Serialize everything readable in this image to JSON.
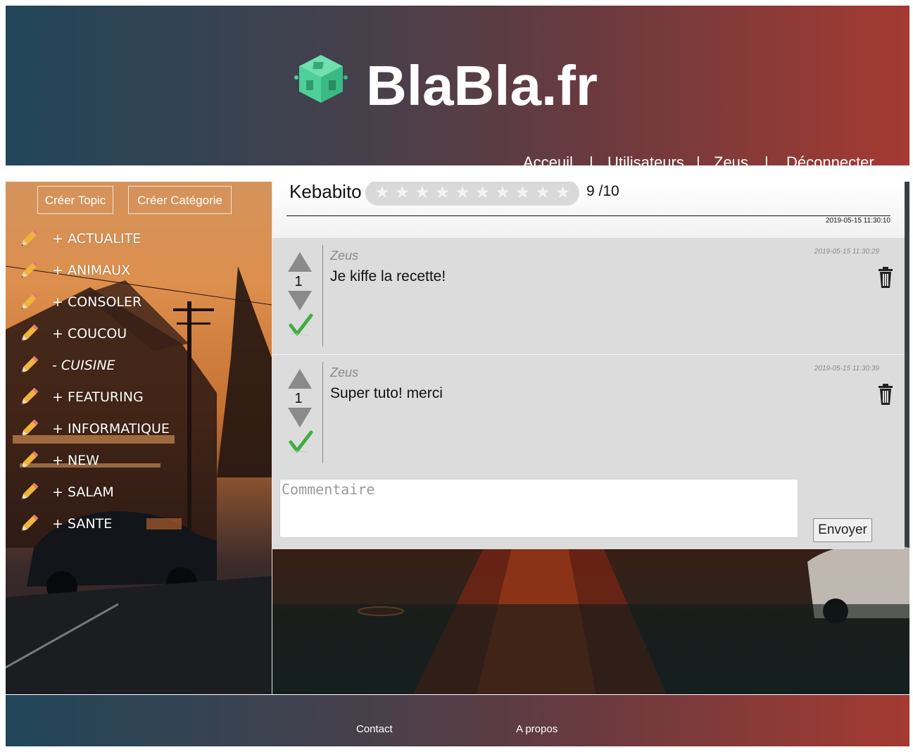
{
  "header": {
    "site_title": "BlaBla.fr",
    "logo_icon": "cube-logo-icon",
    "nav": {
      "home": "Acceuil",
      "users": "Utilisateurs",
      "profile": "Zeus",
      "logout": "Déconnecter",
      "separator": "|"
    }
  },
  "sidebar": {
    "create_topic": "Créer Topic",
    "create_category": "Créer Catégorie",
    "categories": [
      {
        "label": "+ ACTUALITE",
        "icon": "pencil-icon"
      },
      {
        "label": "+ ANIMAUX",
        "icon": "pencil-icon"
      },
      {
        "label": "+ CONSOLER",
        "icon": "pencil-icon"
      },
      {
        "label": "+ COUCOU",
        "icon": "pencil-icon"
      },
      {
        "label": "- CUISINE",
        "icon": "pencil-icon",
        "active": true
      },
      {
        "label": "+ FEATURING",
        "icon": "pencil-icon"
      },
      {
        "label": "+ INFORMATIQUE",
        "icon": "pencil-icon"
      },
      {
        "label": "+ NEW",
        "icon": "pencil-icon"
      },
      {
        "label": "+ SALAM",
        "icon": "pencil-icon"
      },
      {
        "label": "+ SANTE",
        "icon": "pencil-icon"
      }
    ]
  },
  "topic": {
    "title": "Kebabito",
    "rating": {
      "value": 9,
      "max": 10,
      "display": "9 /10",
      "star_glyph": "★"
    },
    "date": "2019-05-15 11:30:10"
  },
  "comments": [
    {
      "author": "Zeus",
      "date": "2019-05-15 11:30:29",
      "text": "Je kiffe la recette!",
      "votes": "1"
    },
    {
      "author": "Zeus",
      "date": "2019-05-15 11:30:39",
      "text": "Super tuto! merci",
      "votes": "1"
    }
  ],
  "comment_form": {
    "placeholder": "Commentaire",
    "value": "",
    "submit_label": "Envoyer"
  },
  "footer": {
    "contact": "Contact",
    "about": "A propos"
  },
  "colors": {
    "header_gradient_start": "#21465a",
    "header_gradient_end": "#a53a31",
    "logo_green": "#4fd09a",
    "check_green": "#3fae3f",
    "comment_bg": "#dcdcdc"
  }
}
